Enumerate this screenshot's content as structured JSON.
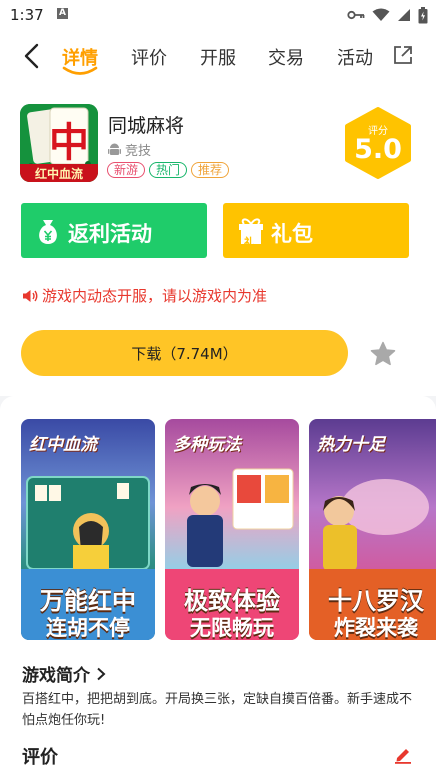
{
  "status_bar": {
    "time": "1:37",
    "notification_letter": "A"
  },
  "nav": {
    "tabs": [
      {
        "label": "详情",
        "active": true
      },
      {
        "label": "评价",
        "active": false
      },
      {
        "label": "开服",
        "active": false
      },
      {
        "label": "交易",
        "active": false
      },
      {
        "label": "活动",
        "active": false
      }
    ]
  },
  "app": {
    "name": "同城麻将",
    "category": "竞技",
    "icon_tile": "中",
    "icon_banner": "红中血流",
    "tags": [
      {
        "label": "新游",
        "color": "#e8506f"
      },
      {
        "label": "热门",
        "color": "#17b56a"
      },
      {
        "label": "推荐",
        "color": "#f0a43a"
      }
    ]
  },
  "score": {
    "label": "评分",
    "value": "5.0"
  },
  "actions": {
    "rebate_label": "返利活动",
    "gift_label": "礼包",
    "gift_icon_text": "礼"
  },
  "notice": "游戏内动态开服，请以游戏内为准",
  "download": {
    "label": "下载（7.74M）"
  },
  "screenshots": [
    {
      "title": "红中血流",
      "line1": "万能红中",
      "line2": "连胡不停"
    },
    {
      "title": "多种玩法",
      "line1": "极致体验",
      "line2": "无限畅玩"
    },
    {
      "title": "热力十足",
      "line1": "十八罗汉",
      "line2": "炸裂来袭"
    }
  ],
  "intro": {
    "title": "游戏简介",
    "body": "百搭红中，把把胡到底。开局换三张，定缺自摸百倍番。新手速成不怕点炮任你玩!"
  },
  "reviews": {
    "title": "评价"
  },
  "colors": {
    "accent": "#ff9f00",
    "green": "#1fcc6a",
    "yellow": "#ffc300",
    "red": "#e8382e"
  }
}
